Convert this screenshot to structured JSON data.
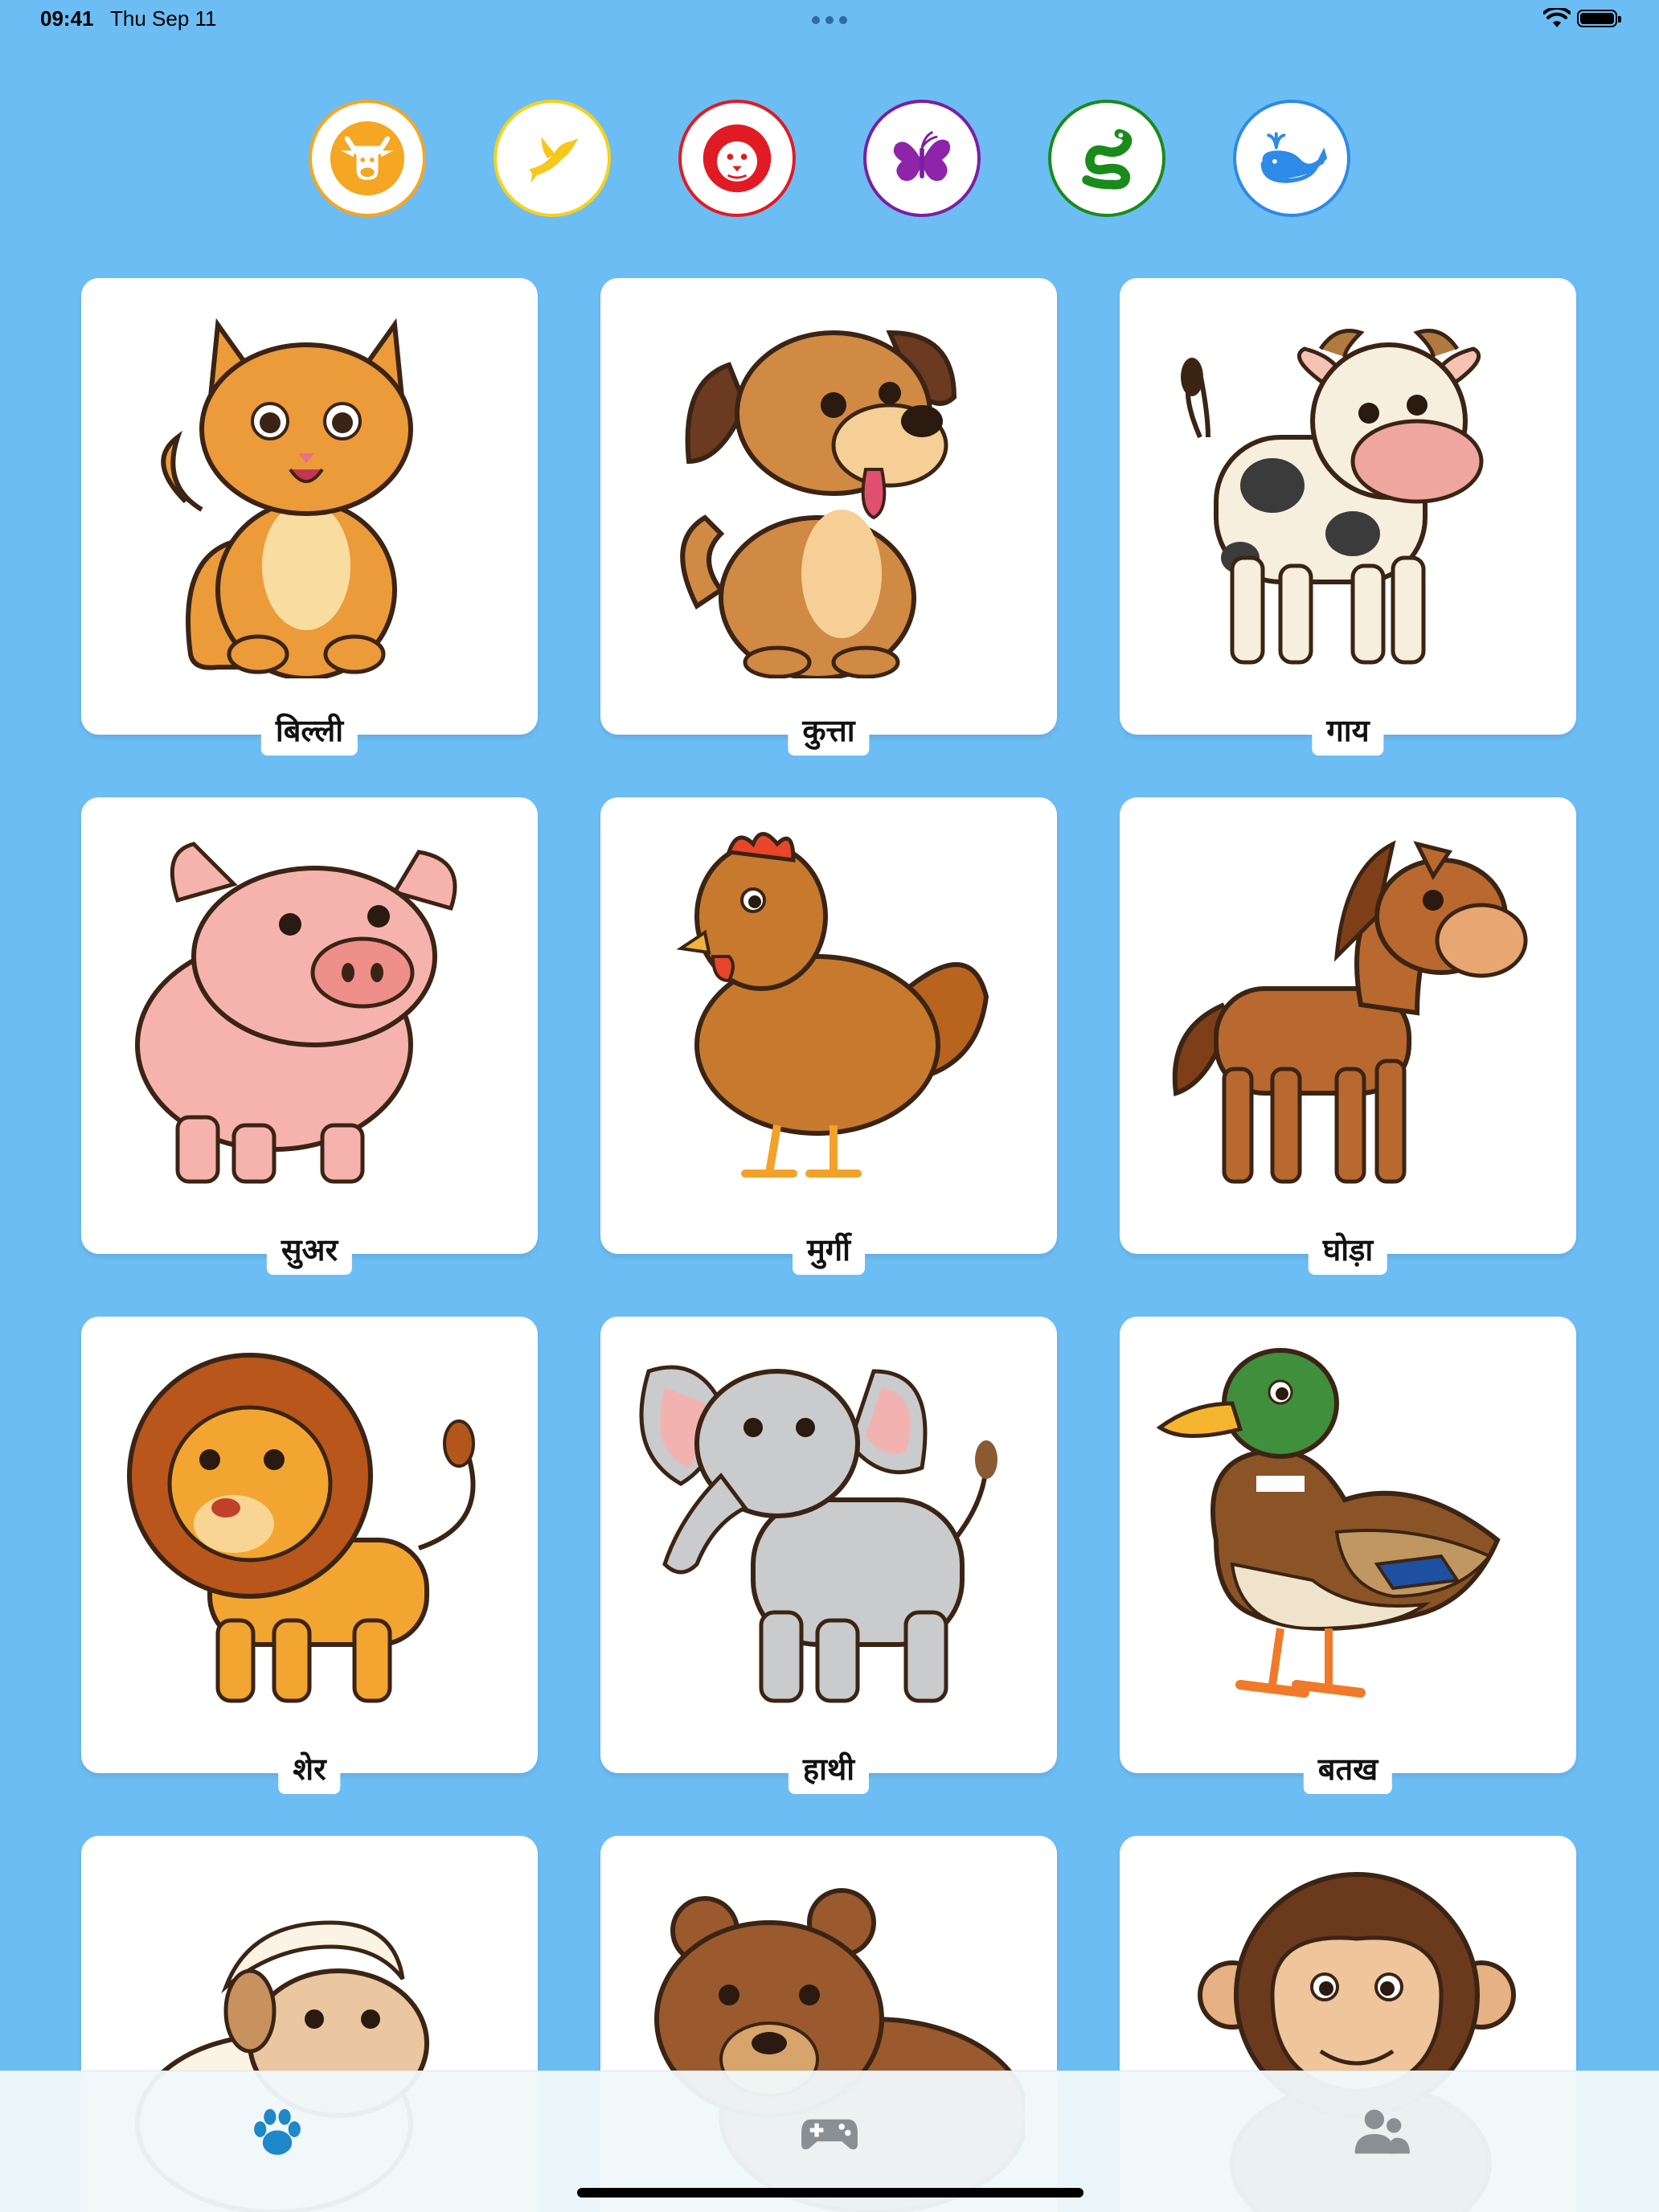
{
  "status_bar": {
    "time": "09:41",
    "date": "Thu Sep 11"
  },
  "categories": [
    {
      "name": "farm",
      "icon": "cow-icon",
      "color": "#f5a623"
    },
    {
      "name": "birds",
      "icon": "bird-icon",
      "color": "#f7d21c"
    },
    {
      "name": "wild",
      "icon": "lion-icon",
      "color": "#e01b24"
    },
    {
      "name": "insects",
      "icon": "butterfly-icon",
      "color": "#7b1fa2"
    },
    {
      "name": "reptiles",
      "icon": "snake-icon",
      "color": "#1a8b1a"
    },
    {
      "name": "sea",
      "icon": "whale-icon",
      "color": "#2d8ae6"
    }
  ],
  "animals": [
    {
      "label": "बिल्ली",
      "icon": "cat-image"
    },
    {
      "label": "कुत्ता",
      "icon": "dog-image"
    },
    {
      "label": "गाय",
      "icon": "cow-image"
    },
    {
      "label": "सुअर",
      "icon": "pig-image"
    },
    {
      "label": "मुर्गी",
      "icon": "hen-image"
    },
    {
      "label": "घोड़ा",
      "icon": "horse-image"
    },
    {
      "label": "शेर",
      "icon": "lion-image"
    },
    {
      "label": "हाथी",
      "icon": "elephant-image"
    },
    {
      "label": "बतख",
      "icon": "duck-image"
    },
    {
      "label": "",
      "icon": "sheep-image"
    },
    {
      "label": "",
      "icon": "bear-image"
    },
    {
      "label": "",
      "icon": "monkey-image"
    }
  ],
  "tab_bar": {
    "tabs": [
      {
        "name": "animals",
        "icon": "paw-icon",
        "active": true,
        "color": "#1e88c8"
      },
      {
        "name": "games",
        "icon": "gamepad-icon",
        "active": false,
        "color": "#8a8f94"
      },
      {
        "name": "profile",
        "icon": "users-icon",
        "active": false,
        "color": "#8a8f94"
      }
    ]
  }
}
